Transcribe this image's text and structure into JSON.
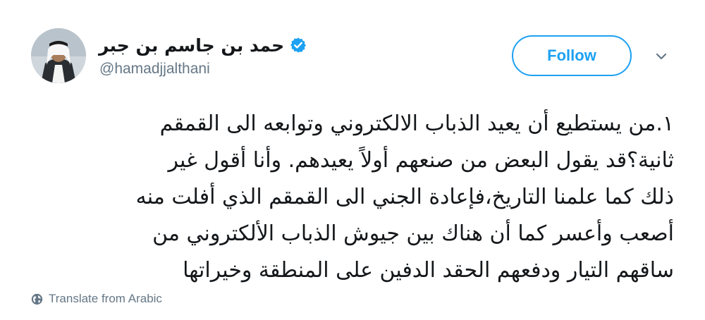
{
  "user": {
    "display_name": "حمد بن جاسم بن جبر",
    "handle": "@hamadjjalthani",
    "verified": true
  },
  "actions": {
    "follow_label": "Follow",
    "caret_icon": "chevron-down-icon"
  },
  "tweet": {
    "lines": [
      "١.من يستطيع أن يعيد الذباب الالكتروني وتوابعه الى القمقم",
      "ثانية؟قد يقول البعض من صنعهم أولاً يعيدهم. وأنا أقول غير",
      "ذلك كما علمنا التاريخ،فإعادة الجني الى القمقم الذي أفلت منه",
      "أصعب وأعسر كما أن هناك بين جيوش الذباب الألكتروني من",
      "ساقهم التيار ودفعهم الحقد الدفين على المنطقة وخيراتها"
    ]
  },
  "translate": {
    "label": "Translate from Arabic",
    "icon": "globe-icon"
  },
  "colors": {
    "accent": "#1da1f2",
    "text_primary": "#14171a",
    "text_secondary": "#657786"
  }
}
